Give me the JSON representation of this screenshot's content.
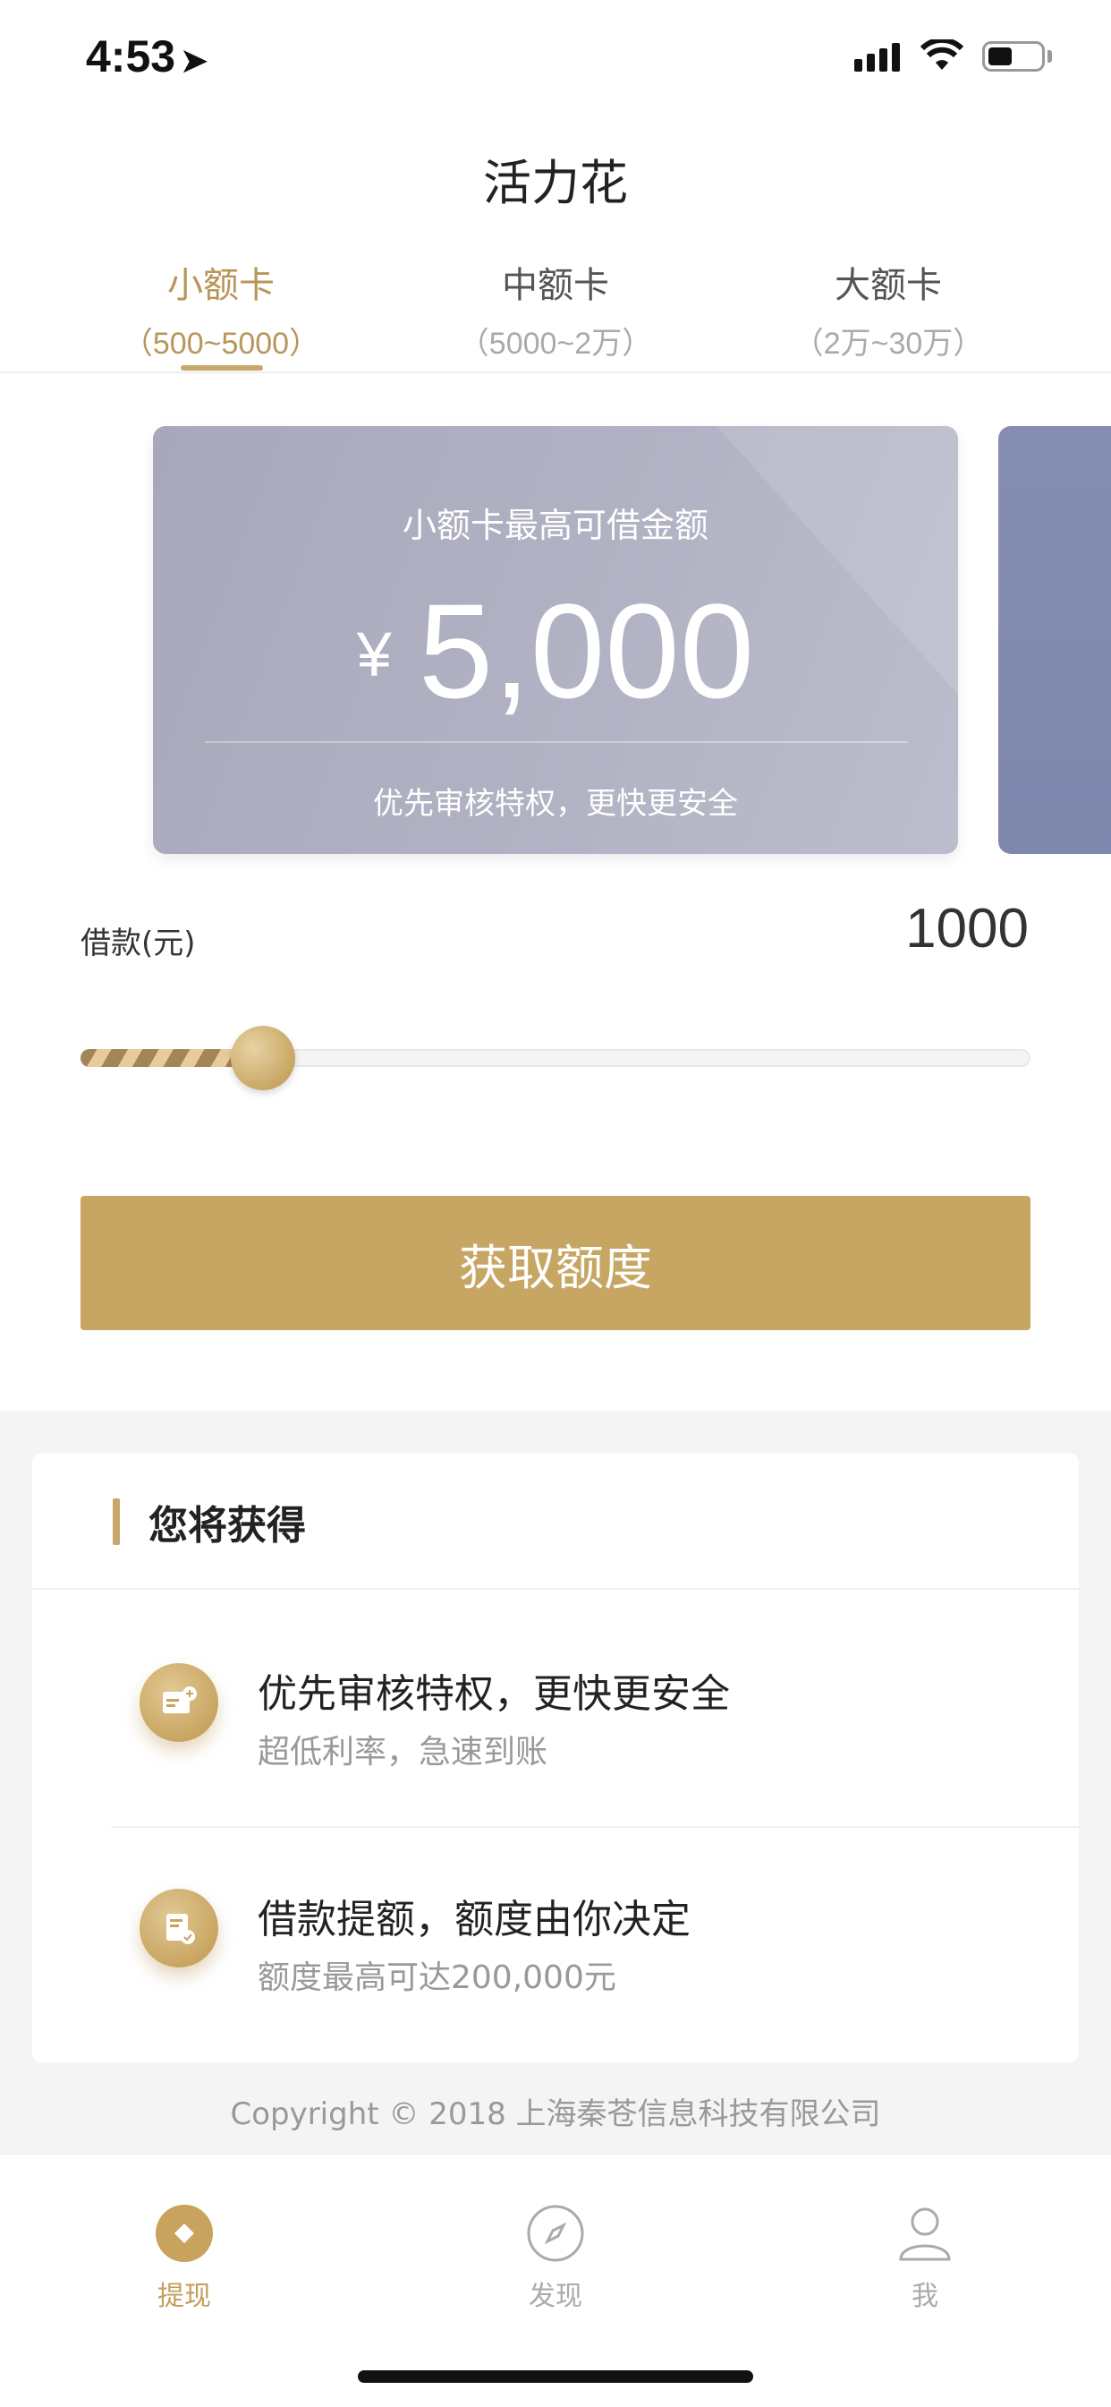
{
  "status_bar": {
    "time": "4:53"
  },
  "app_title": "活力花",
  "tabs": [
    {
      "label": "小额卡",
      "range": "（500~5000）",
      "active": true
    },
    {
      "label": "中额卡",
      "range": "（5000~2万）",
      "active": false
    },
    {
      "label": "大额卡",
      "range": "（2万~30万）",
      "active": false
    }
  ],
  "card": {
    "label": "小额卡最高可借金额",
    "currency": "¥",
    "amount": "5,000",
    "subtitle": "优先审核特权，更快更安全"
  },
  "loan": {
    "label": "借款(元)",
    "value": "1000",
    "slider_fraction": 0.2
  },
  "cta_label": "获取额度",
  "benefits": {
    "title": "您将获得",
    "items": [
      {
        "title": "优先审核特权，更快更安全",
        "subtitle": "超低利率，急速到账",
        "icon": "card-icon"
      },
      {
        "title": "借款提额，额度由你决定",
        "subtitle": "额度最高可达200,000元",
        "icon": "document-check-icon"
      }
    ]
  },
  "copyright": "Copyright © 2018 上海秦苍信息科技有限公司",
  "bottom_nav": [
    {
      "label": "提现",
      "icon": "diamond-icon",
      "active": true
    },
    {
      "label": "发现",
      "icon": "compass-icon",
      "active": false
    },
    {
      "label": "我",
      "icon": "person-icon",
      "active": false
    }
  ],
  "colors": {
    "accent": "#c7a664",
    "card": "#b1b2c3"
  }
}
